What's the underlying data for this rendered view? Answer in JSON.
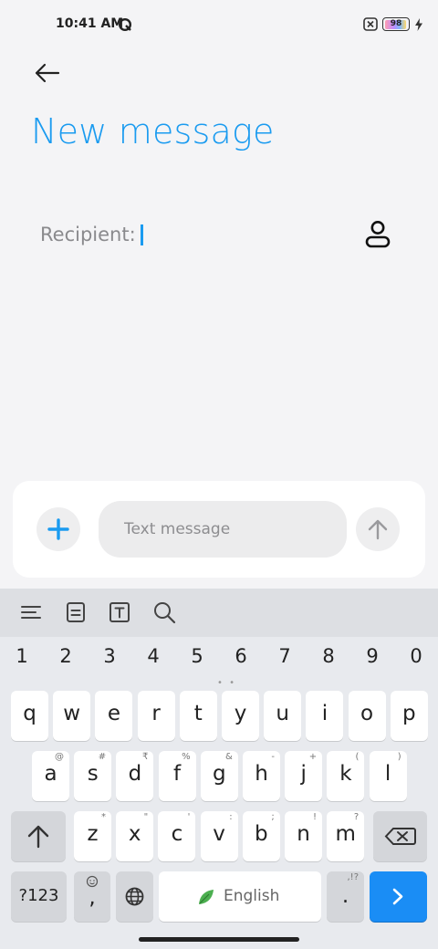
{
  "status": {
    "time": "10:41 AM",
    "battery": "98"
  },
  "header": {
    "title": "New message"
  },
  "recipient": {
    "label": "Recipient:"
  },
  "compose": {
    "placeholder": "Text message"
  },
  "keyboard": {
    "numbers": [
      "1",
      "2",
      "3",
      "4",
      "5",
      "6",
      "7",
      "8",
      "9",
      "0"
    ],
    "row1": [
      "q",
      "w",
      "e",
      "r",
      "t",
      "y",
      "u",
      "i",
      "o",
      "p"
    ],
    "row2": [
      {
        "k": "a",
        "h": "@"
      },
      {
        "k": "s",
        "h": "#"
      },
      {
        "k": "d",
        "h": "₹"
      },
      {
        "k": "f",
        "h": "%"
      },
      {
        "k": "g",
        "h": "&"
      },
      {
        "k": "h",
        "h": "-"
      },
      {
        "k": "j",
        "h": "+"
      },
      {
        "k": "k",
        "h": "("
      },
      {
        "k": "l",
        "h": ")"
      }
    ],
    "row3": [
      {
        "k": "z",
        "h": "*"
      },
      {
        "k": "x",
        "h": "\""
      },
      {
        "k": "c",
        "h": "'"
      },
      {
        "k": "v",
        "h": ":"
      },
      {
        "k": "b",
        "h": ";"
      },
      {
        "k": "n",
        "h": "!"
      },
      {
        "k": "m",
        "h": "?"
      }
    ],
    "sym_label": "?123",
    "comma": ",",
    "period": ".",
    "period_hint": ",!?",
    "space_label": "English"
  },
  "colors": {
    "accent": "#1a9bf0",
    "enter": "#1a8df5"
  }
}
